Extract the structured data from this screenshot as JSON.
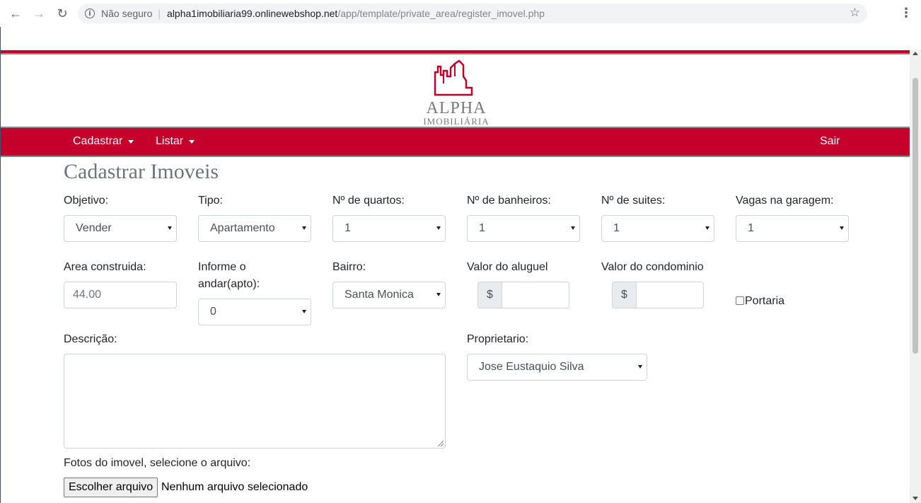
{
  "browser": {
    "security_label": "Não seguro",
    "url_host": "alpha1imobiliaria99.onlinewebshop.net",
    "url_path": "/app/template/private_area/register_imovel.php"
  },
  "logo": {
    "title": "ALPHA",
    "subtitle": "IMOBILIÁRIA"
  },
  "navbar": {
    "items": [
      {
        "label": "Cadastrar"
      },
      {
        "label": "Listar"
      }
    ],
    "logout_label": "Sair"
  },
  "page": {
    "title": "Cadastrar Imoveis"
  },
  "form": {
    "objetivo": {
      "label": "Objetivo:",
      "value": "Vender"
    },
    "tipo": {
      "label": "Tipo:",
      "value": "Apartamento"
    },
    "quartos": {
      "label": "Nº de quartos:",
      "value": "1"
    },
    "banheiros": {
      "label": "Nº de banheiros:",
      "value": "1"
    },
    "suites": {
      "label": "Nº de suites:",
      "value": "1"
    },
    "vagas": {
      "label": "Vagas na garagem:",
      "value": "1"
    },
    "area": {
      "label": "Area construida:",
      "value": "44.00"
    },
    "andar": {
      "label_line1": "Informe o",
      "label_line2": "andar(apto):",
      "value": "0"
    },
    "bairro": {
      "label": "Bairro:",
      "value": "Santa Monica"
    },
    "aluguel": {
      "label": "Valor do aluguel",
      "prefix": "$",
      "value": ""
    },
    "condominio": {
      "label": "Valor do condominio",
      "prefix": "$",
      "value": ""
    },
    "portaria": {
      "label": "Portaria",
      "checked": false
    },
    "descricao": {
      "label": "Descrição:",
      "value": ""
    },
    "proprietario": {
      "label": "Proprietario:",
      "value": "Jose Eustaquio Silva"
    },
    "fotos": {
      "label": "Fotos do imovel, selecione o arquivo:",
      "button_label": "Escolher arquivo",
      "status": "Nenhum arquivo selecionado"
    }
  },
  "colors": {
    "brand_red": "#c4002b",
    "title_gray": "#6c757d"
  }
}
